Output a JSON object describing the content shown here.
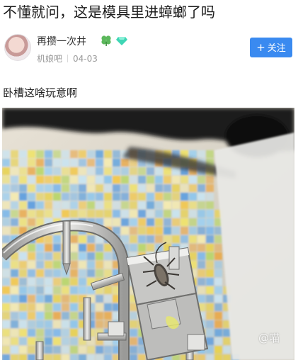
{
  "post": {
    "title": "不懂就问，这是模具里进蟑螂了吗",
    "text": "卧槽这啥玩意啊"
  },
  "author": {
    "name": "再攒一次井",
    "forum": "机娘吧",
    "date": "04-03",
    "badges": [
      "clover-icon",
      "diamond-icon"
    ]
  },
  "actions": {
    "follow_label": "关注",
    "follow_icon": "plus-icon"
  },
  "image": {
    "watermark": "@喵"
  },
  "colors": {
    "accent": "#3a8af0",
    "meta_text": "#9a9a9a"
  }
}
